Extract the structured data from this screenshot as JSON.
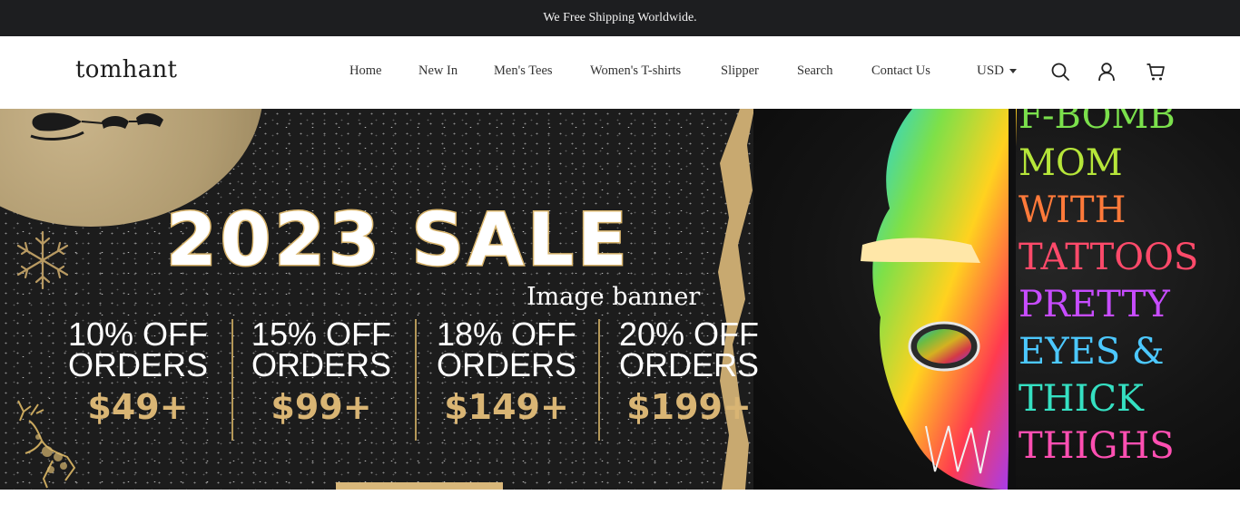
{
  "announcement": {
    "text": "We Free Shipping Worldwide."
  },
  "header": {
    "logo": "tomhant",
    "nav": [
      {
        "label": "Home"
      },
      {
        "label": "New In"
      },
      {
        "label": "Men's Tees"
      },
      {
        "label": "Women's T-shirts"
      },
      {
        "label": "Slipper"
      },
      {
        "label": "Search"
      },
      {
        "label": "Contact Us"
      }
    ],
    "currency": "USD",
    "icons": [
      "search-icon",
      "account-icon",
      "cart-icon"
    ]
  },
  "banner": {
    "headline": "2023 SALE",
    "caption": "Image banner",
    "offers": [
      {
        "percent": "10% OFF",
        "orders": "ORDERS",
        "amount": "$49+"
      },
      {
        "percent": "15% OFF",
        "orders": "ORDERS",
        "amount": "$99+"
      },
      {
        "percent": "18% OFF",
        "orders": "ORDERS",
        "amount": "$149+"
      },
      {
        "percent": "20% OFF",
        "orders": "ORDERS",
        "amount": "$199+"
      }
    ],
    "shirt_text": [
      "F-BOMB",
      "MOM",
      "WITH",
      "TATTOOS",
      "PRETTY",
      "EYES &",
      "THICK",
      "THIGHS"
    ],
    "colors": {
      "gold": "#d9b574",
      "dark": "#1d1e20"
    }
  }
}
